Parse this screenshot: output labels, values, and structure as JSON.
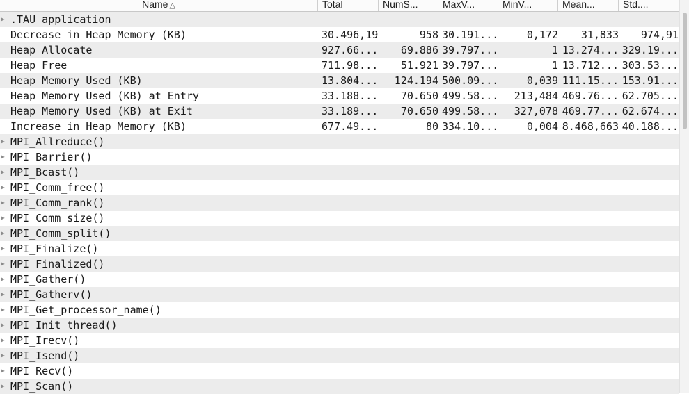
{
  "columns": {
    "name": "Name",
    "sort_indicator": "△",
    "total": "Total",
    "nums": "NumS...",
    "maxv": "MaxV...",
    "minv": "MinV...",
    "mean": "Mean...",
    "std": "Std...."
  },
  "rows": [
    {
      "name": ".TAU application",
      "expandable": true,
      "total": "",
      "nums": "",
      "maxv": "",
      "minv": "",
      "mean": "",
      "std": ""
    },
    {
      "name": "Decrease in Heap Memory (KB)",
      "expandable": false,
      "total": "30.496,19",
      "nums": "958",
      "maxv": "30.191...",
      "minv": "0,172",
      "mean": "31,833",
      "std": "974,91"
    },
    {
      "name": "Heap Allocate",
      "expandable": false,
      "total": "927.66...",
      "nums": "69.886",
      "maxv": "39.797...",
      "minv": "1",
      "mean": "13.274...",
      "std": "329.19..."
    },
    {
      "name": "Heap Free",
      "expandable": false,
      "total": "711.98...",
      "nums": "51.921",
      "maxv": "39.797...",
      "minv": "1",
      "mean": "13.712...",
      "std": "303.53..."
    },
    {
      "name": "Heap Memory Used (KB)",
      "expandable": false,
      "total": "13.804...",
      "nums": "124.194",
      "maxv": "500.09...",
      "minv": "0,039",
      "mean": "111.15...",
      "std": "153.91..."
    },
    {
      "name": "Heap Memory Used (KB) at Entry",
      "expandable": false,
      "total": "33.188...",
      "nums": "70.650",
      "maxv": "499.58...",
      "minv": "213,484",
      "mean": "469.76...",
      "std": "62.705..."
    },
    {
      "name": "Heap Memory Used (KB) at Exit",
      "expandable": false,
      "total": "33.189...",
      "nums": "70.650",
      "maxv": "499.58...",
      "minv": "327,078",
      "mean": "469.77...",
      "std": "62.674..."
    },
    {
      "name": "Increase in Heap Memory (KB)",
      "expandable": false,
      "total": "677.49...",
      "nums": "80",
      "maxv": "334.10...",
      "minv": "0,004",
      "mean": "8.468,663",
      "std": "40.188..."
    },
    {
      "name": "MPI_Allreduce()",
      "expandable": true,
      "total": "",
      "nums": "",
      "maxv": "",
      "minv": "",
      "mean": "",
      "std": ""
    },
    {
      "name": "MPI_Barrier()",
      "expandable": true,
      "total": "",
      "nums": "",
      "maxv": "",
      "minv": "",
      "mean": "",
      "std": ""
    },
    {
      "name": "MPI_Bcast()",
      "expandable": true,
      "total": "",
      "nums": "",
      "maxv": "",
      "minv": "",
      "mean": "",
      "std": ""
    },
    {
      "name": "MPI_Comm_free()",
      "expandable": true,
      "total": "",
      "nums": "",
      "maxv": "",
      "minv": "",
      "mean": "",
      "std": ""
    },
    {
      "name": "MPI_Comm_rank()",
      "expandable": true,
      "total": "",
      "nums": "",
      "maxv": "",
      "minv": "",
      "mean": "",
      "std": ""
    },
    {
      "name": "MPI_Comm_size()",
      "expandable": true,
      "total": "",
      "nums": "",
      "maxv": "",
      "minv": "",
      "mean": "",
      "std": ""
    },
    {
      "name": "MPI_Comm_split()",
      "expandable": true,
      "total": "",
      "nums": "",
      "maxv": "",
      "minv": "",
      "mean": "",
      "std": ""
    },
    {
      "name": "MPI_Finalize()",
      "expandable": true,
      "total": "",
      "nums": "",
      "maxv": "",
      "minv": "",
      "mean": "",
      "std": ""
    },
    {
      "name": "MPI_Finalized()",
      "expandable": true,
      "total": "",
      "nums": "",
      "maxv": "",
      "minv": "",
      "mean": "",
      "std": ""
    },
    {
      "name": "MPI_Gather()",
      "expandable": true,
      "total": "",
      "nums": "",
      "maxv": "",
      "minv": "",
      "mean": "",
      "std": ""
    },
    {
      "name": "MPI_Gatherv()",
      "expandable": true,
      "total": "",
      "nums": "",
      "maxv": "",
      "minv": "",
      "mean": "",
      "std": ""
    },
    {
      "name": "MPI_Get_processor_name()",
      "expandable": true,
      "total": "",
      "nums": "",
      "maxv": "",
      "minv": "",
      "mean": "",
      "std": ""
    },
    {
      "name": "MPI_Init_thread()",
      "expandable": true,
      "total": "",
      "nums": "",
      "maxv": "",
      "minv": "",
      "mean": "",
      "std": ""
    },
    {
      "name": "MPI_Irecv()",
      "expandable": true,
      "total": "",
      "nums": "",
      "maxv": "",
      "minv": "",
      "mean": "",
      "std": ""
    },
    {
      "name": "MPI_Isend()",
      "expandable": true,
      "total": "",
      "nums": "",
      "maxv": "",
      "minv": "",
      "mean": "",
      "std": ""
    },
    {
      "name": "MPI_Recv()",
      "expandable": true,
      "total": "",
      "nums": "",
      "maxv": "",
      "minv": "",
      "mean": "",
      "std": ""
    },
    {
      "name": "MPI_Scan()",
      "expandable": true,
      "total": "",
      "nums": "",
      "maxv": "",
      "minv": "",
      "mean": "",
      "std": ""
    }
  ],
  "icons": {
    "expand": "disclosure-triangle-icon",
    "sort": "sort-ascending-icon"
  }
}
